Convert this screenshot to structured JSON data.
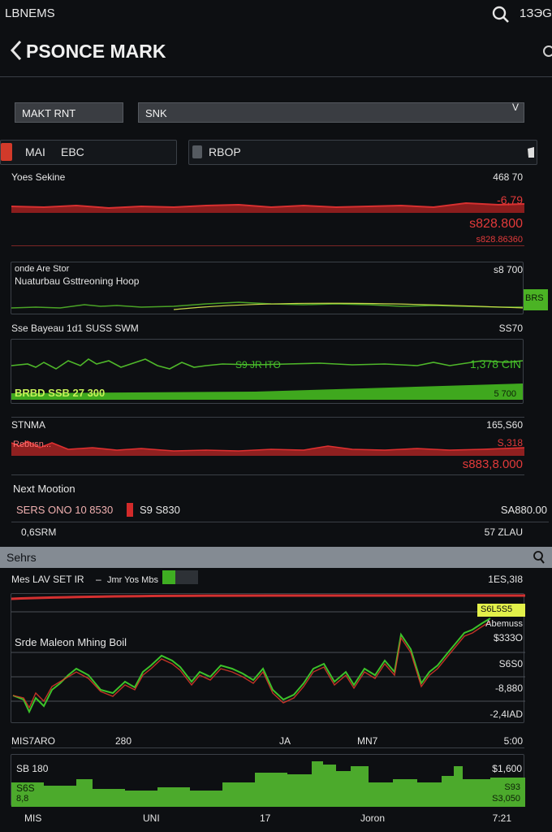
{
  "statusbar": {
    "app": "LBNEMS",
    "time": "1ЗЭG"
  },
  "header": {
    "title": "PSONCE MARK"
  },
  "filters": {
    "left_value": "MAKT RNT",
    "right_value": "SNK",
    "dropdown_glyph": "V"
  },
  "tabs": [
    {
      "label": "MAI",
      "sub": "EBC"
    },
    {
      "label": "RBOP"
    }
  ],
  "section1": {
    "title": "Yoes Sekine",
    "v1": "468 70",
    "v2": "-6,79",
    "v3": "s828.800",
    "v4": "s828.86360"
  },
  "section2": {
    "line1": "onde Are Stor",
    "line2": "Nuaturbau Gsttreoning Hoop",
    "v1": "s8 700",
    "badge": "BRS"
  },
  "section3": {
    "title": "Sse Bayeau 1d1 SUSS SWM",
    "v1": "SS70",
    "mid": "S9 JR ITO",
    "right": "1,378 CIN",
    "bar_left": "BRBD SSB 27 300",
    "bar_right": "5 700"
  },
  "section4": {
    "title": "STNMA",
    "v1": "165,S60",
    "v2": "S,318",
    "v3": "s883,8.000",
    "overlay": "Rebusn..."
  },
  "next_motion": {
    "title": "Next Mootion",
    "left": "SERS ONO 10 8530",
    "mid": "S9 S830",
    "right": "SA880.00",
    "sub_left": "0,6SRM",
    "sub_right": "57 ZLAU"
  },
  "searchbar": {
    "label": "Sehrs"
  },
  "series": {
    "left": "Mes LAV SET IR",
    "sep": "–",
    "mid": "Jmr Yos Mbs",
    "right": "1ES,3I8",
    "title": "Srde Maleon Mhing Boil",
    "price_tag": "S6L5S5",
    "tag_sub": "Abemuss",
    "y_labels": [
      "$333O",
      "S6S0",
      "-8,880",
      "-2,4IAD"
    ]
  },
  "xaxis1": [
    "MIS7ARO",
    "280",
    "JA",
    "MN7",
    "5:00"
  ],
  "volume": {
    "left_top": "SB 180",
    "right_top": "$1,600",
    "left_mid": "S6S",
    "left_sub": "8,8",
    "right_mid": "S93",
    "right_sub": "S3,050"
  },
  "xaxis2": [
    "MIS",
    "UNI",
    "17",
    "Joron",
    "7:21"
  ],
  "colors": {
    "bg": "#0d0f12",
    "red": "#c72a2a",
    "green": "#47b520",
    "yellow": "#e3f14a"
  },
  "icons": [
    "search-icon",
    "back-chevron-icon",
    "overflow-icon",
    "dropdown-icon",
    "gear-icon"
  ]
}
